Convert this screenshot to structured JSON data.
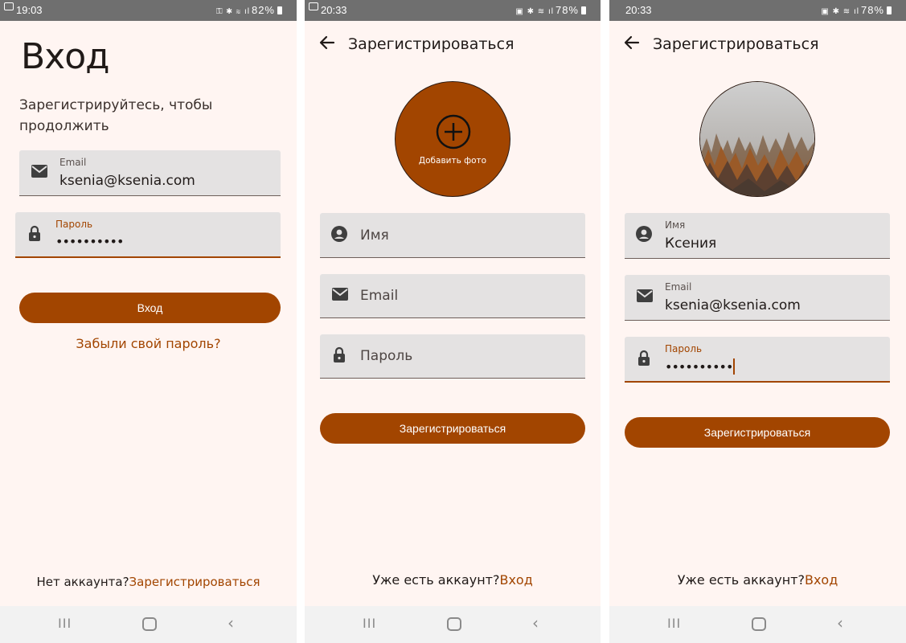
{
  "screen1": {
    "status": {
      "time": "19:03",
      "battery": "82%"
    },
    "title": "Вход",
    "subtitle": "Зарегистрируйтесь, чтобы продолжить",
    "email": {
      "label": "Email",
      "value": "ksenia@ksenia.com",
      "icon": "mail-icon"
    },
    "password": {
      "label": "Пароль",
      "value": "••••••••••",
      "icon": "lock-icon"
    },
    "login_button": "Вход",
    "forgot_link": "Забыли свой пароль?",
    "bottom": {
      "prompt": "Нет аккаунта?",
      "link": "Зарегистрироваться"
    }
  },
  "screen2": {
    "status": {
      "time": "20:33",
      "battery": "78%"
    },
    "title": "Зарегистрироваться",
    "add_photo": "Добавить фото",
    "name": {
      "placeholder": "Имя",
      "icon": "account-circle-icon"
    },
    "email": {
      "placeholder": "Email",
      "icon": "mail-icon"
    },
    "password": {
      "placeholder": "Пароль",
      "icon": "lock-icon"
    },
    "register_button": "Зарегистрироваться",
    "bottom": {
      "prompt": "Уже есть аккаунт?",
      "link": "Вход"
    }
  },
  "screen3": {
    "status": {
      "time": "20:33",
      "battery": "78%"
    },
    "title": "Зарегистрироваться",
    "name": {
      "label": "Имя",
      "value": "Ксения",
      "icon": "account-circle-icon"
    },
    "email": {
      "label": "Email",
      "value": "ksenia@ksenia.com",
      "icon": "mail-icon"
    },
    "password": {
      "label": "Пароль",
      "value": "••••••••••",
      "icon": "lock-icon"
    },
    "register_button": "Зарегистрироваться",
    "bottom": {
      "prompt": "Уже есть аккаунт?",
      "link": "Вход"
    }
  },
  "colors": {
    "accent": "#a24500",
    "background": "#fff5f2",
    "field": "#e4e2e2",
    "statusbar": "#6f6f6f"
  }
}
